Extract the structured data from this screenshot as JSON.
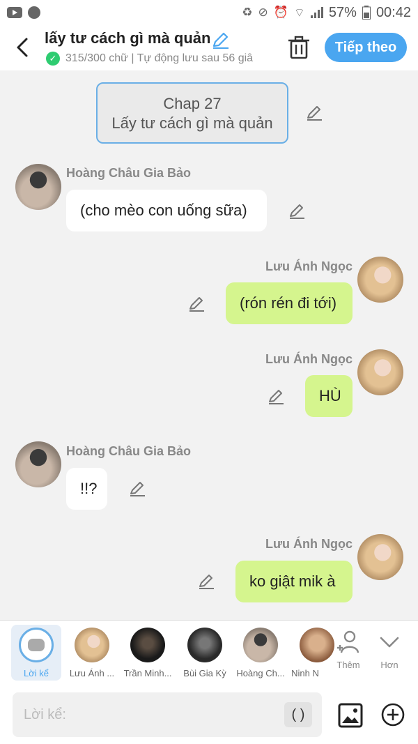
{
  "status_bar": {
    "battery": "57%",
    "time": "00:42"
  },
  "header": {
    "title": "lấy tư cách gì mà quản",
    "subtitle": "315/300 chữ | Tự động lưu sau 56 giâ",
    "next_label": "Tiếp theo"
  },
  "chapter": {
    "line1": "Chap 27",
    "line2": "Lấy tư cách gì mà quản"
  },
  "messages": [
    {
      "sender": "Hoàng Châu Gia Bảo",
      "text": "(cho mèo con uống sữa)",
      "side": "left"
    },
    {
      "sender": "Lưu Ánh Ngọc",
      "text": "(rón rén đi tới)",
      "side": "right"
    },
    {
      "sender": "Lưu Ánh Ngọc",
      "text": "HÙ",
      "side": "right"
    },
    {
      "sender": "Hoàng Châu Gia Bảo",
      "text": "!!?",
      "side": "left"
    },
    {
      "sender": "Lưu Ánh Ngọc",
      "text": "ko giật mik à",
      "side": "right"
    }
  ],
  "characters": [
    {
      "label": "Lời kể",
      "active": true
    },
    {
      "label": "Lưu Ánh ..."
    },
    {
      "label": "Trần Minh..."
    },
    {
      "label": "Bùi Gia Kỳ"
    },
    {
      "label": "Hoàng Ch..."
    },
    {
      "label": "Ninh N"
    }
  ],
  "tools": {
    "add_label": "Thêm",
    "more_label": "Hơn"
  },
  "input": {
    "placeholder": "Lời kể:",
    "paren_label": "( )"
  },
  "colors": {
    "accent": "#4aa6f0",
    "outgoing_bubble": "#d5f58e",
    "incoming_bubble": "#ffffff",
    "check": "#2ecc71"
  },
  "icons": [
    "back-arrow-icon",
    "pencil-icon",
    "check-icon",
    "trash-icon",
    "add-person-icon",
    "chevron-down-icon",
    "image-icon",
    "plus-circle-icon"
  ]
}
